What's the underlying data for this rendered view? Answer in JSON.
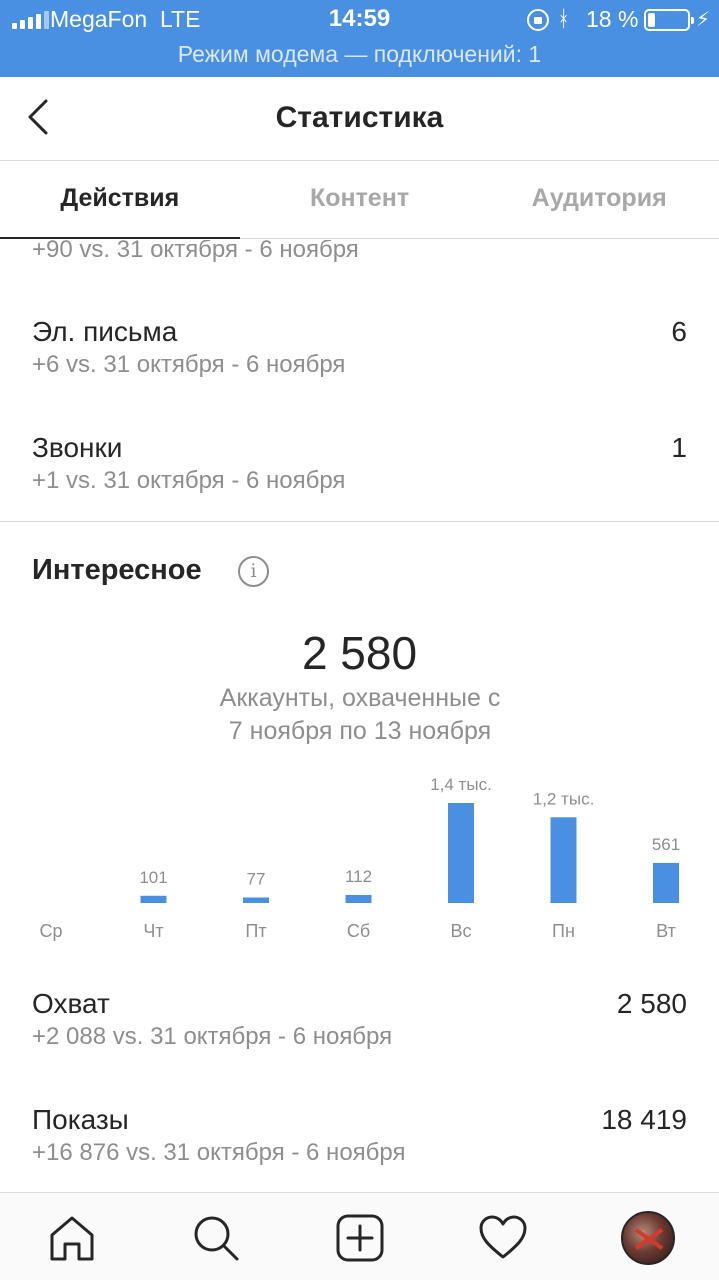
{
  "status_bar": {
    "carrier": "MegaFon",
    "network": "LTE",
    "time": "14:59",
    "battery": "18 %",
    "battery_level": 0.18,
    "hotspot": "Режим модема — подключений: 1"
  },
  "header": {
    "title": "Статистика"
  },
  "tabs": [
    {
      "label": "Действия"
    },
    {
      "label": "Контент"
    },
    {
      "label": "Аудитория"
    }
  ],
  "actions": {
    "partial_sub": "+90 vs. 31 октября - 6 ноября",
    "items": [
      {
        "label": "Эл. письма",
        "value": "6",
        "sub": "+6 vs. 31 октября - 6 ноября"
      },
      {
        "label": "Звонки",
        "value": "1",
        "sub": "+1 vs. 31 октября - 6 ноября"
      }
    ]
  },
  "discovery": {
    "title": "Интересное",
    "total": "2 580",
    "subtitle_line1": "Аккаунты, охваченные с",
    "subtitle_line2": "7 ноября по 13 ноября",
    "metrics": [
      {
        "label": "Охват",
        "value": "2 580",
        "sub": "+2 088 vs. 31 октября - 6 ноября"
      },
      {
        "label": "Показы",
        "value": "18 419",
        "sub": "+16 876 vs. 31 октября - 6 ноября"
      }
    ]
  },
  "chart_data": {
    "type": "bar",
    "categories": [
      "Ср",
      "Чт",
      "Пт",
      "Сб",
      "Вс",
      "Пн",
      "Вт"
    ],
    "values": [
      0,
      101,
      77,
      112,
      1400,
      1200,
      561
    ],
    "labels": [
      "",
      "101",
      "77",
      "112",
      "1,4 тыс.",
      "1,2 тыс.",
      "561"
    ],
    "color": "#4a90e2"
  },
  "colors": {
    "accent": "#4a90e2",
    "status_bar": "#4a90e2",
    "muted_text": "#8e8e8e"
  },
  "bottom_nav": [
    {
      "icon": "home-icon"
    },
    {
      "icon": "search-icon"
    },
    {
      "icon": "add-post-icon"
    },
    {
      "icon": "heart-icon"
    },
    {
      "icon": "profile-avatar"
    }
  ]
}
